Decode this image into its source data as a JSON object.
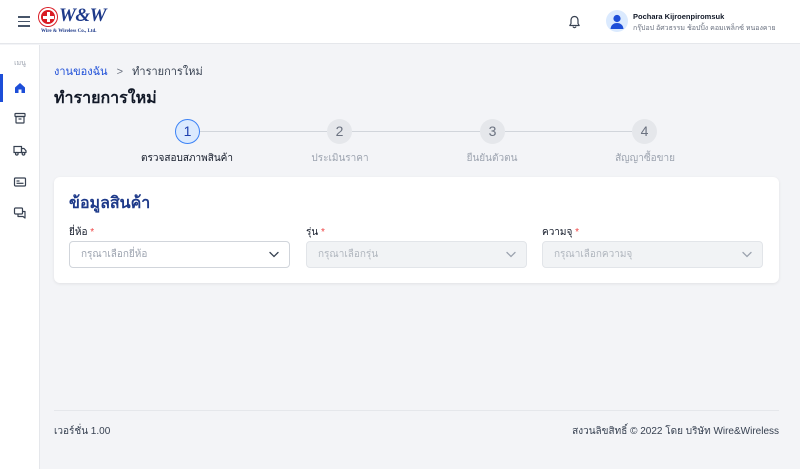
{
  "header": {
    "logo_text": "W&W",
    "logo_subtext": "Wire & Wireless Co., Ltd.",
    "user_name": "Pochara Kijroenpiromsuk",
    "user_company": "กรุ๊ปอป อัศวธรรม ช้อปปิ้ง คอมเพล็กซ์ หนองคาย",
    "icons": [
      "menu-icon",
      "bell-icon",
      "user-icon"
    ]
  },
  "sidebar": {
    "menu_label": "เมนู",
    "items": [
      {
        "name": "home-icon",
        "active": true
      },
      {
        "name": "archive-icon",
        "active": false
      },
      {
        "name": "truck-icon",
        "active": false
      },
      {
        "name": "id-card-icon",
        "active": false
      },
      {
        "name": "chat-icon",
        "active": false
      }
    ]
  },
  "breadcrumb": {
    "parent": "งานของฉัน",
    "separator": ">",
    "current": "ทำรายการใหม่"
  },
  "page_title": "ทำรายการใหม่",
  "stepper": {
    "steps": [
      {
        "number": "1",
        "label": "ตรวจสอบสภาพสินค้า",
        "active": true
      },
      {
        "number": "2",
        "label": "ประเมินราคา",
        "active": false
      },
      {
        "number": "3",
        "label": "ยืนยันตัวตน",
        "active": false
      },
      {
        "number": "4",
        "label": "สัญญาซื้อขาย",
        "active": false
      }
    ]
  },
  "form": {
    "title": "ข้อมูลสินค้า",
    "required_mark": "*",
    "fields": [
      {
        "label": "ยี่ห้อ",
        "placeholder": "กรุณาเลือกยี่ห้อ",
        "enabled": true
      },
      {
        "label": "รุ่น",
        "placeholder": "กรุณาเลือกรุ่น",
        "enabled": false
      },
      {
        "label": "ความจุ",
        "placeholder": "กรุณาเลือกความจุ",
        "enabled": false
      }
    ]
  },
  "footer": {
    "version": "เวอร์ชั่น 1.00",
    "copyright": "สงวนลิขสิทธิ์ © 2022 โดย บริษัท Wire&Wireless"
  },
  "colors": {
    "primary": "#1d4ed8",
    "title_blue": "#1e3a8a",
    "brand_red": "#d91c24",
    "required": "#ef4444"
  }
}
